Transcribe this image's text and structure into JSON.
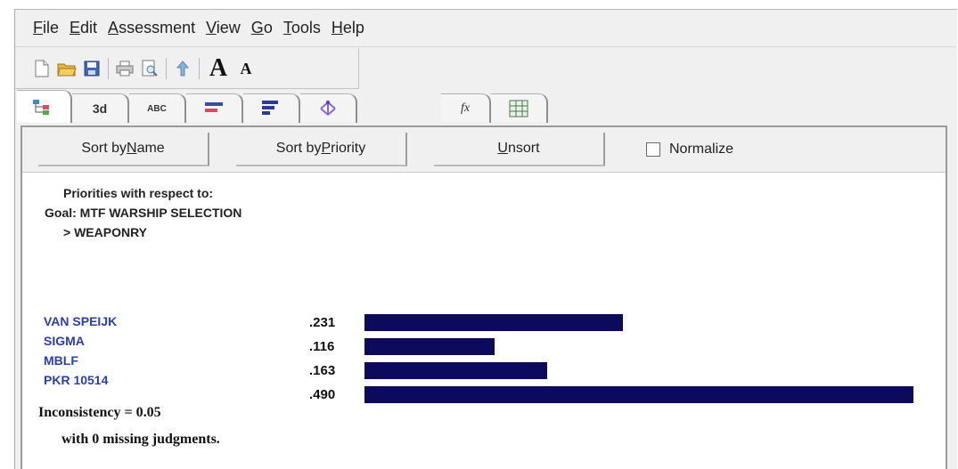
{
  "menu": [
    {
      "pre": "",
      "mn": "F",
      "post": "ile"
    },
    {
      "pre": "",
      "mn": "E",
      "post": "dit"
    },
    {
      "pre": "",
      "mn": "A",
      "post": "ssessment"
    },
    {
      "pre": "",
      "mn": "V",
      "post": "iew"
    },
    {
      "pre": "",
      "mn": "G",
      "post": "o"
    },
    {
      "pre": "",
      "mn": "T",
      "post": "ools"
    },
    {
      "pre": "",
      "mn": "H",
      "post": "elp"
    }
  ],
  "toolbar": {
    "icons": [
      "new-file-icon",
      "open-folder-icon",
      "save-icon",
      "print-icon",
      "print-preview-icon",
      "move-up-icon",
      "font-larger-icon",
      "font-smaller-icon"
    ],
    "font_larger_glyph": "A",
    "font_smaller_glyph": "A"
  },
  "tabs": [
    {
      "name": "tree-view-tab",
      "icon": "tree-icon"
    },
    {
      "name": "3d-tab",
      "label": "3d"
    },
    {
      "name": "abc-tab",
      "label": "ABC"
    },
    {
      "name": "bars-tab",
      "icon": "bars-icon"
    },
    {
      "name": "priority-bars-tab",
      "icon": "priority-bars-icon"
    },
    {
      "name": "hierarchy-tab",
      "icon": "hierarchy-icon"
    },
    {
      "name": "formula-tab",
      "label": "fx"
    },
    {
      "name": "grid-tab",
      "icon": "grid-icon"
    }
  ],
  "sort": {
    "by_name": {
      "pre": "Sort by ",
      "mn": "N",
      "post": "ame"
    },
    "by_priority": {
      "pre": "Sort by ",
      "mn": "P",
      "post": "riority"
    },
    "unsort": {
      "pre": "",
      "mn": "U",
      "post": "nsort"
    },
    "normalize": "Normalize"
  },
  "priorities": {
    "line1": "Priorities with respect to:",
    "line2": "Goal: MTF WARSHIP SELECTION",
    "line3": "> WEAPONRY"
  },
  "alternatives": [
    {
      "name": "VAN SPEIJK",
      "value_label": ".231",
      "value": 0.231
    },
    {
      "name": "SIGMA",
      "value_label": ".116",
      "value": 0.116
    },
    {
      "name": "MBLF",
      "value_label": ".163",
      "value": 0.163
    },
    {
      "name": "PKR 10514",
      "value_label": ".490",
      "value": 0.49
    }
  ],
  "bar_color": "#0c0a5c",
  "inconsistency": {
    "line1": "Inconsistency = 0.05",
    "line2": "with 0  missing judgments."
  }
}
